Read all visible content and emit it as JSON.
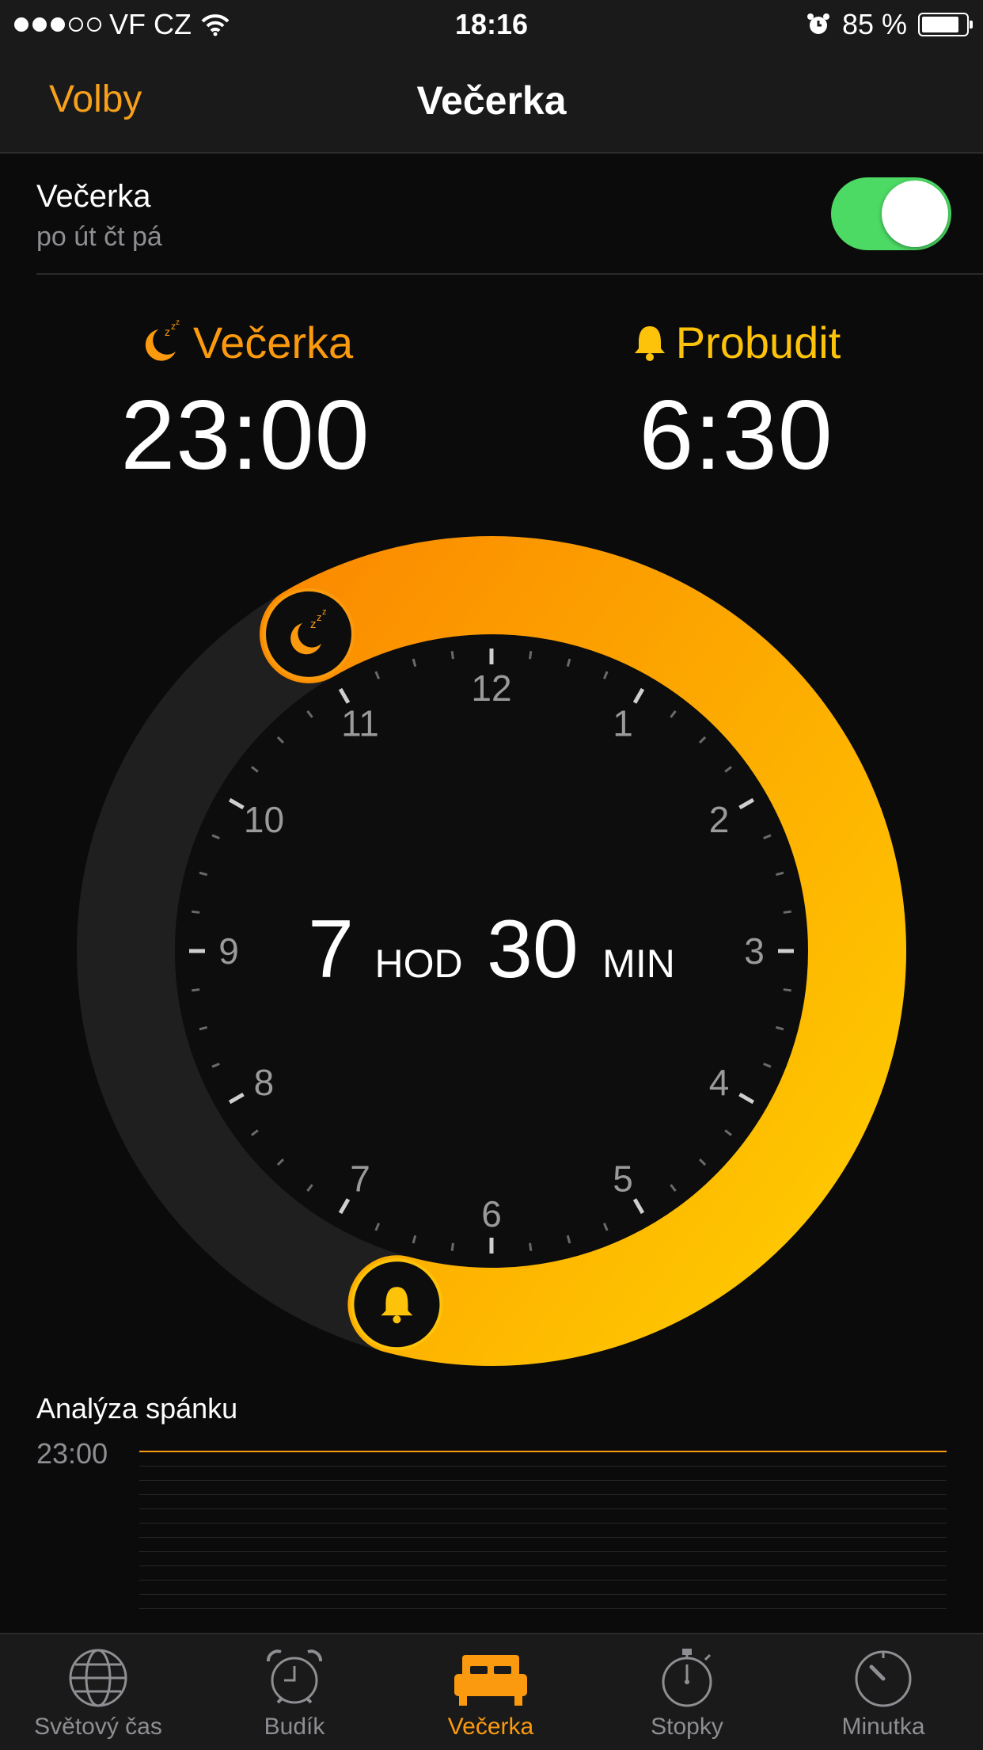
{
  "status_bar": {
    "carrier": "VF CZ",
    "time": "18:16",
    "battery_percent": "85 %",
    "battery_level": 0.85,
    "signal_bars": 3,
    "icons": [
      "wifi-icon",
      "alarm-icon",
      "battery-icon"
    ]
  },
  "nav": {
    "left_label": "Volby",
    "title": "Večerka"
  },
  "bedtime_row": {
    "title": "Večerka",
    "days": "po út čt pá",
    "enabled": true
  },
  "bedtime": {
    "label": "Večerka",
    "time": "23:00",
    "icon": "moon-zzz-icon"
  },
  "wake": {
    "label": "Probudit",
    "time": "6:30",
    "icon": "bell-icon"
  },
  "dial": {
    "hours_value": "7",
    "hours_unit": "HOD",
    "minutes_value": "30",
    "minutes_unit": "MIN",
    "numbers": [
      "12",
      "1",
      "2",
      "3",
      "4",
      "5",
      "6",
      "7",
      "8",
      "9",
      "10",
      "11"
    ],
    "start_hour": 23.0,
    "end_hour": 6.5
  },
  "analysis": {
    "title": "Analýza spánku",
    "time": "23:00"
  },
  "tabs": [
    {
      "label": "Světový čas",
      "icon": "globe-icon",
      "active": false
    },
    {
      "label": "Budík",
      "icon": "alarm-clock-icon",
      "active": false
    },
    {
      "label": "Večerka",
      "icon": "bed-icon",
      "active": true
    },
    {
      "label": "Stopky",
      "icon": "stopwatch-icon",
      "active": false
    },
    {
      "label": "Minutka",
      "icon": "timer-icon",
      "active": false
    }
  ],
  "colors": {
    "accent_orange": "#fb9a0e",
    "accent_yellow": "#fcc30a",
    "toggle_on": "#4cd964",
    "secondary_text": "#8e8e93"
  }
}
